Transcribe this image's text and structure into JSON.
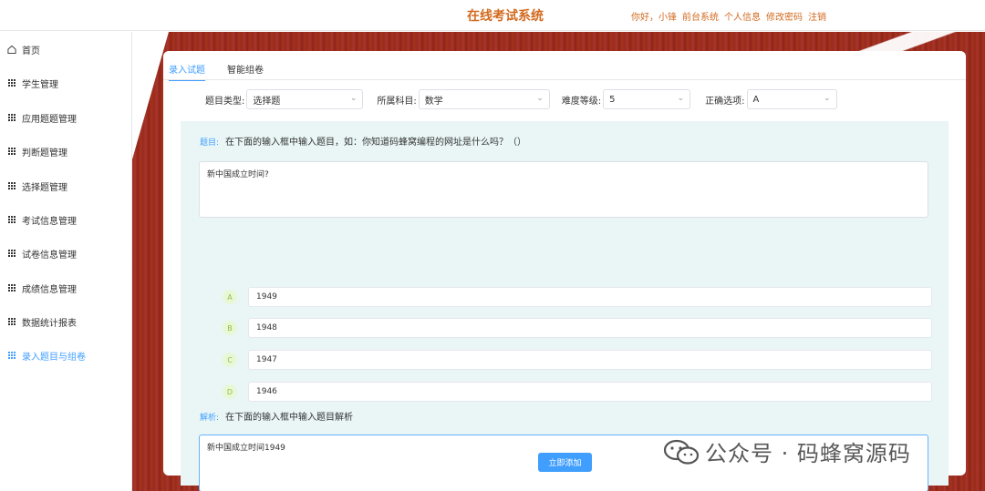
{
  "header": {
    "title": "在线考试系统",
    "links": [
      "你好，小锋",
      "前台系统",
      "个人信息",
      "修改密码",
      "注销"
    ]
  },
  "sidebar": {
    "items": [
      {
        "label": "首页",
        "icon": "home-icon"
      },
      {
        "label": "学生管理",
        "icon": "grid-icon"
      },
      {
        "label": "应用题题管理",
        "icon": "grid-icon"
      },
      {
        "label": "判断题管理",
        "icon": "grid-icon"
      },
      {
        "label": "选择题管理",
        "icon": "grid-icon"
      },
      {
        "label": "考试信息管理",
        "icon": "grid-icon"
      },
      {
        "label": "试卷信息管理",
        "icon": "grid-icon"
      },
      {
        "label": "成绩信息管理",
        "icon": "grid-icon"
      },
      {
        "label": "数据统计报表",
        "icon": "grid-icon"
      },
      {
        "label": "录入题目与组卷",
        "icon": "grid-icon",
        "active": true
      }
    ]
  },
  "tabs": [
    {
      "label": "录入试题",
      "active": true
    },
    {
      "label": "智能组卷",
      "active": false
    }
  ],
  "filters": {
    "type_label": "题目类型:",
    "type_value": "选择题",
    "subject_label": "所属科目:",
    "subject_value": "数学",
    "level_label": "难度等级:",
    "level_value": "5",
    "answer_label": "正确选项:",
    "answer_value": "A"
  },
  "question": {
    "label": "题目:",
    "hint": "在下面的输入框中输入题目，如：你知道码蜂窝编程的网址是什么吗？（）",
    "value": "新中国成立时间?"
  },
  "options": [
    {
      "letter": "A",
      "value": "1949"
    },
    {
      "letter": "B",
      "value": "1948"
    },
    {
      "letter": "C",
      "value": "1947"
    },
    {
      "letter": "D",
      "value": "1946"
    }
  ],
  "analysis": {
    "label": "解析:",
    "hint": "在下面的输入框中输入题目解析",
    "value": "新中国成立时间1949"
  },
  "submit_label": "立即添加",
  "watermark": "公众号 · 码蜂窝源码",
  "colors": {
    "accent": "#409eff",
    "header_text": "#d26a1f",
    "wood": "#9b2b1f",
    "form_bg": "#eaf6f6"
  }
}
